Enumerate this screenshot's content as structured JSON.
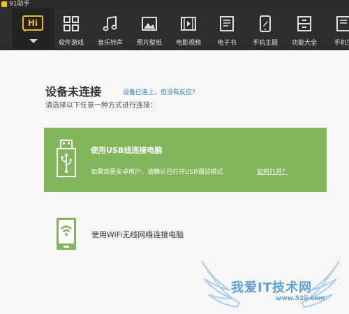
{
  "window": {
    "title": "91助手"
  },
  "toolbar": {
    "home_icon_text": "Hi",
    "items": [
      {
        "label": "软件游戏",
        "icon": "apps-grid-icon"
      },
      {
        "label": "音乐铃声",
        "icon": "music-note-icon"
      },
      {
        "label": "照片壁纸",
        "icon": "picture-icon"
      },
      {
        "label": "电影视频",
        "icon": "film-icon"
      },
      {
        "label": "电子书",
        "icon": "ebook-icon"
      },
      {
        "label": "手机主题",
        "icon": "phone-theme-icon"
      },
      {
        "label": "功能大全",
        "icon": "toolbox-icon"
      },
      {
        "label": "手机生",
        "icon": "phone-icon"
      }
    ]
  },
  "main": {
    "title": "设备未连接",
    "help_link": "设备已连上，但没有反应？",
    "instruction": "请选择以下任意一种方式进行连接：",
    "usb": {
      "title": "使用USB线连接电脑",
      "description": "如果您是安卓用户，请确认已打开USB调试模式",
      "help_link": "如何打开？",
      "accent_color": "#82b65a"
    },
    "wifi": {
      "title": "使用WiFi无线网络连接电脑",
      "icon_color": "#82b65a"
    }
  },
  "watermark": {
    "title": "我爱IT技术网",
    "site": "www.52ij.com"
  }
}
